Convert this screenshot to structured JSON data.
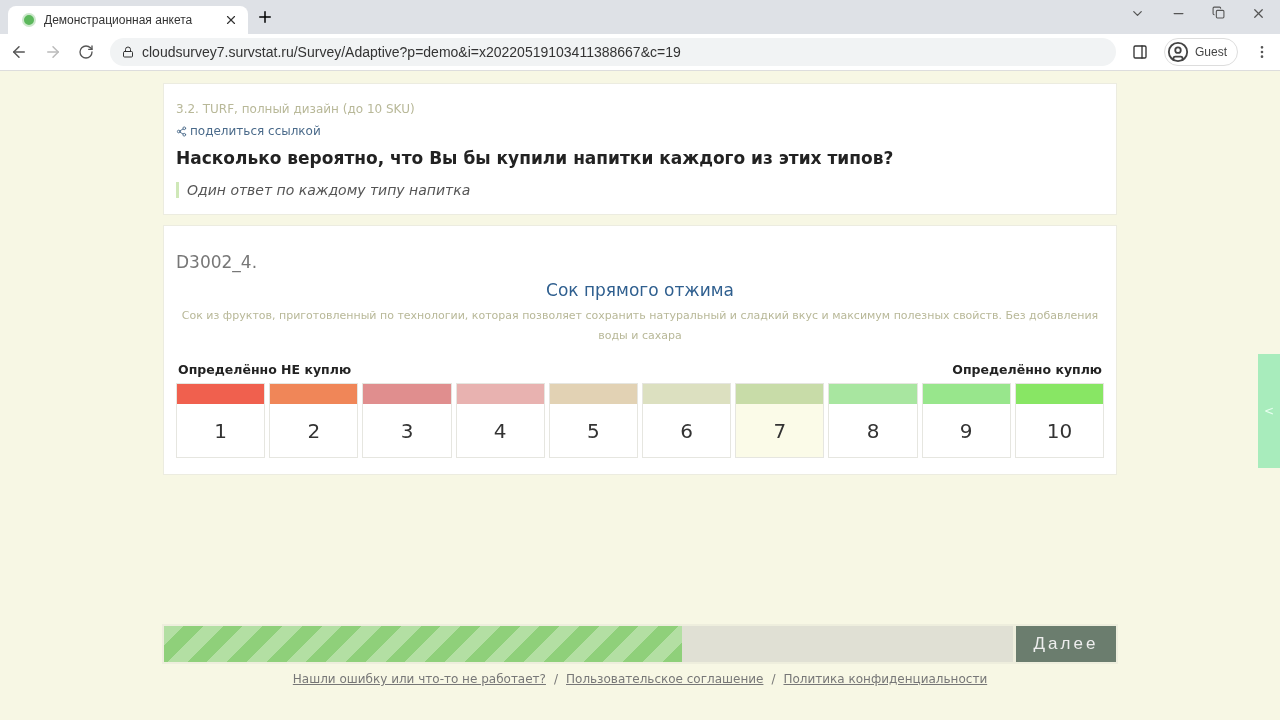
{
  "browser": {
    "tab_title": "Демонстрационная анкета",
    "url": "cloudsurvey7.survstat.ru/Survey/Adaptive?p=demo&i=x20220519103411388667&c=19",
    "profile": "Guest"
  },
  "header": {
    "section": "3.2. TURF, полный дизайн (до 10 SKU)",
    "share_link": "поделиться ссылкой",
    "question": "Насколько вероятно, что Вы бы купили напитки каждого из этих типов?",
    "instruction": "Один ответ по каждому типу напитка"
  },
  "item": {
    "code": "D3002_4.",
    "title": "Сок прямого отжима",
    "description": "Сок из фруктов, приготовленный по технологии, которая позволяет сохранить натуральный и сладкий вкус и максимум полезных свойств.  Без добавления воды и сахара",
    "low_label": "Определённо НЕ куплю",
    "high_label": "Определённо куплю",
    "scale": [
      {
        "label": "1",
        "color": "#f0604e",
        "hovered": false
      },
      {
        "label": "2",
        "color": "#f08658",
        "hovered": false
      },
      {
        "label": "3",
        "color": "#e08e8e",
        "hovered": false
      },
      {
        "label": "4",
        "color": "#e8b2b0",
        "hovered": false
      },
      {
        "label": "5",
        "color": "#e2d2b4",
        "hovered": false
      },
      {
        "label": "6",
        "color": "#dce0c0",
        "hovered": false
      },
      {
        "label": "7",
        "color": "#c8dca8",
        "hovered": true
      },
      {
        "label": "8",
        "color": "#a8e6a0",
        "hovered": false
      },
      {
        "label": "9",
        "color": "#98e68c",
        "hovered": false
      },
      {
        "label": "10",
        "color": "#88e664",
        "hovered": false
      }
    ]
  },
  "progress": {
    "level": 0.61
  },
  "next_button": "Далее",
  "footer": [
    {
      "kind": "link",
      "text": "Нашли ошибку или что-то не работает?"
    },
    {
      "kind": "separator",
      "text": "/"
    },
    {
      "kind": "link",
      "text": "Пользовательское соглашение"
    },
    {
      "kind": "separator",
      "text": "/"
    },
    {
      "kind": "link",
      "text": "Политика конфиденциальности"
    }
  ],
  "side_tab": "<"
}
